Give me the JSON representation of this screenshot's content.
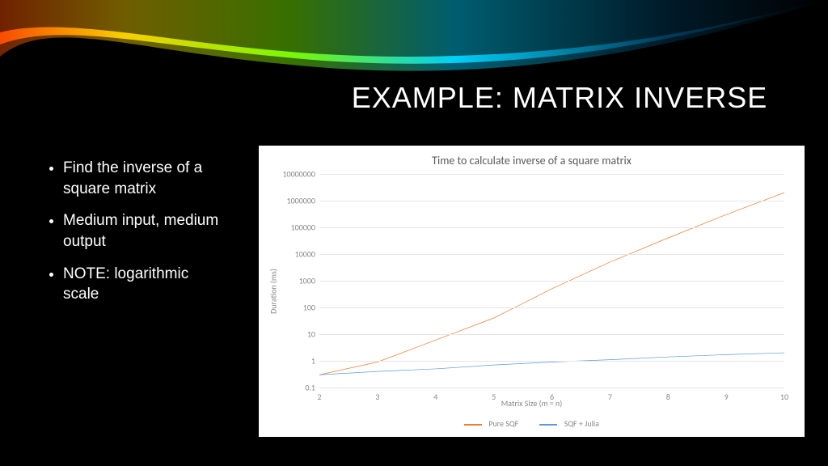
{
  "slide": {
    "title": "EXAMPLE: MATRIX INVERSE",
    "bullets": [
      "Find the inverse of a square matrix",
      "Medium input, medium output",
      "NOTE: logarithmic scale"
    ]
  },
  "chart_data": {
    "type": "line",
    "title": "Time to calculate inverse of a square matrix",
    "xlabel": "Matrix Size (m = n)",
    "ylabel": "Duration (ms)",
    "x_ticks": [
      2,
      3,
      4,
      5,
      6,
      7,
      8,
      9,
      10
    ],
    "y_ticks": [
      0.1,
      1,
      10,
      100,
      1000,
      10000,
      100000,
      1000000,
      10000000
    ],
    "y_scale": "log",
    "ylim": [
      0.1,
      10000000
    ],
    "xlim": [
      2,
      10
    ],
    "categories": [
      2,
      3,
      4,
      5,
      6,
      7,
      8,
      9,
      10
    ],
    "series": [
      {
        "name": "Pure SQF",
        "color": "#ed7d31",
        "values": [
          0.3,
          0.9,
          6,
          40,
          500,
          5000,
          40000,
          300000,
          2000000
        ]
      },
      {
        "name": "SQF + Julia",
        "color": "#5b9bd5",
        "values": [
          0.3,
          0.4,
          0.5,
          0.7,
          0.9,
          1.1,
          1.4,
          1.7,
          2.0
        ]
      }
    ],
    "legend_position": "bottom",
    "grid": true
  }
}
